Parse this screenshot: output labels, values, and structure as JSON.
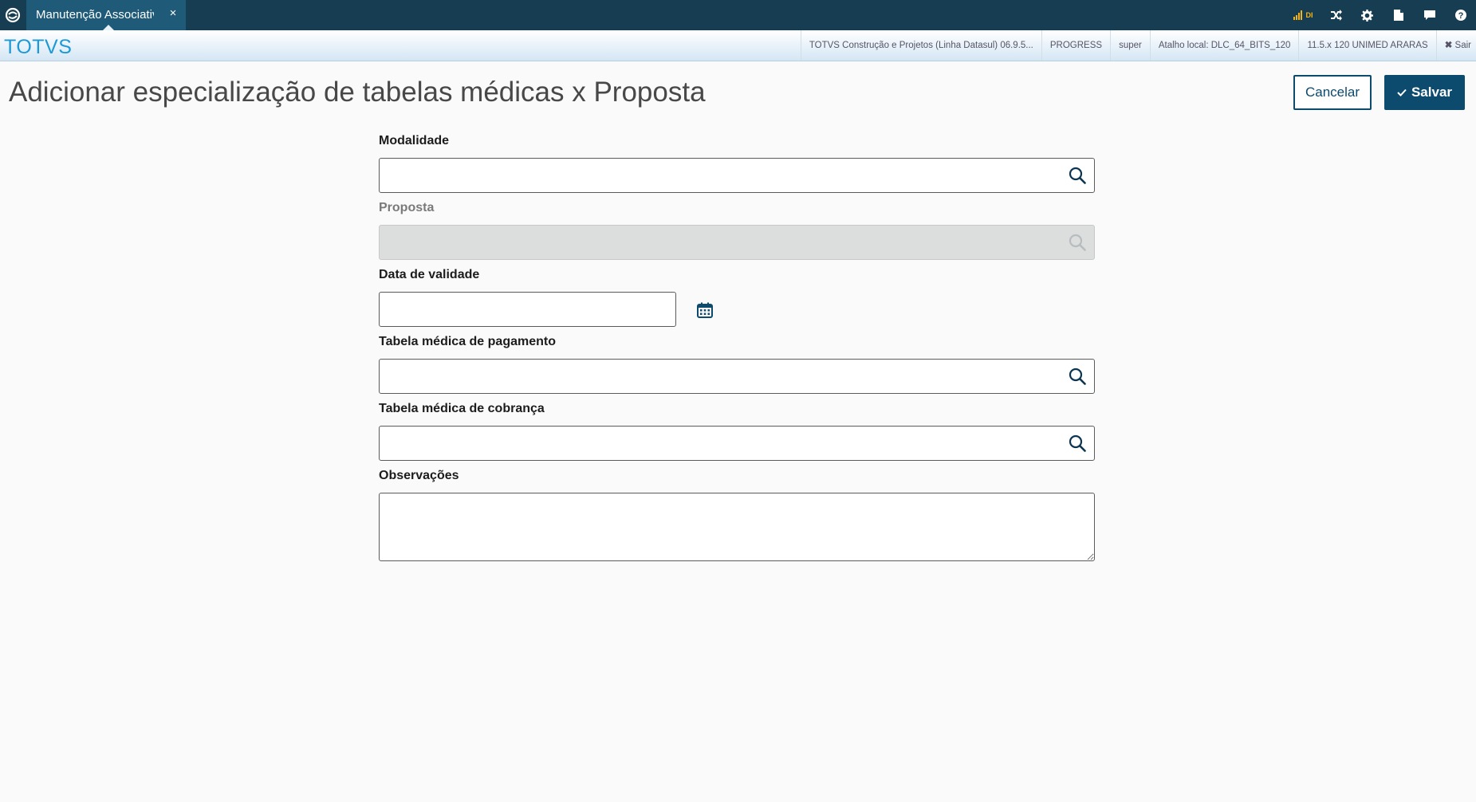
{
  "tab": {
    "label": "Manutenção Associativ",
    "close": "×"
  },
  "topbar": {
    "signal_text": "DI",
    "icons": [
      "signal-icon",
      "shuffle-icon",
      "gear-icon",
      "document-icon",
      "chat-icon",
      "help-icon"
    ]
  },
  "brand": "TOTVS",
  "info": {
    "product": "TOTVS Construção e Projetos (Linha Datasul) 06.9.5...",
    "db": "PROGRESS",
    "user": "super",
    "shortcut": "Atalho local: DLC_64_BITS_120",
    "company": "11.5.x 120 UNIMED ARARAS",
    "exit": "Sair"
  },
  "page": {
    "title": "Adicionar especialização de tabelas médicas x Proposta",
    "cancel_label": "Cancelar",
    "save_label": "Salvar"
  },
  "form": {
    "modalidade": {
      "label": "Modalidade",
      "value": ""
    },
    "proposta": {
      "label": "Proposta",
      "value": ""
    },
    "data_validade": {
      "label": "Data de validade",
      "value": ""
    },
    "tabela_pagamento": {
      "label": "Tabela médica de pagamento",
      "value": ""
    },
    "tabela_cobranca": {
      "label": "Tabela médica de cobrança",
      "value": ""
    },
    "observacoes": {
      "label": "Observações",
      "value": ""
    }
  },
  "colors": {
    "topbar": "#163d52",
    "tab": "#1f5a78",
    "brand": "#1d9ad6",
    "primary": "#0c4a6e",
    "disabled_field": "#dcdede"
  }
}
